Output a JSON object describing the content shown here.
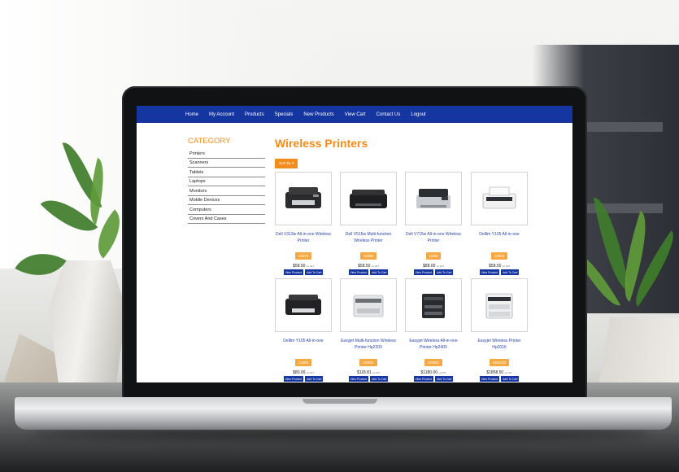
{
  "nav": [
    "Home",
    "My Account",
    "Products",
    "Specials",
    "New Products",
    "View Cart",
    "Contact Us",
    "Logout"
  ],
  "sidebar": {
    "title": "CATEGORY",
    "items": [
      "Printers",
      "Scanners",
      "Tablets",
      "Laptops",
      "Monitors",
      "Mobile Devices",
      "Computers",
      "Covers And Cases"
    ]
  },
  "page": {
    "title": "Wireless Printers",
    "sort_label": "Sort By ▾"
  },
  "products": [
    {
      "name": "Dell V313w All-in-one Wireless Printer",
      "sku": "1X0Y6",
      "price": "$58.50",
      "tax": "inc GST",
      "view": "View Product",
      "cart": "Add To Cart"
    },
    {
      "name": "Dell V515w Multi-function Wireless Printer",
      "sku": "1X0B0",
      "price": "$58.50",
      "tax": "inc GST",
      "view": "View Product",
      "cart": "Add To Cart"
    },
    {
      "name": "Dell V715w All-in-one Wireless Printer",
      "sku": "1X0I8",
      "price": "$88.00",
      "tax": "inc GST",
      "view": "View Product",
      "cart": "Add To Cart"
    },
    {
      "name": "Delltm Y105 All-in-one",
      "sku": "1X004",
      "price": "$58.50",
      "tax": "inc GST",
      "view": "View Product",
      "cart": "Add To Cart"
    },
    {
      "name": "Delltm Y105 All-in-one",
      "sku": "1X0D8",
      "price": "$80.00",
      "tax": "inc GST",
      "view": "View Product",
      "cart": "Add To Cart"
    },
    {
      "name": "Easyjet Multi-function Wireless Printer Hp2200",
      "sku": "HM001",
      "price": "$118.81",
      "tax": "inc GST",
      "view": "View Product",
      "cart": "Add To Cart"
    },
    {
      "name": "Easyjet Wireless All-in-one Printer Hp2400",
      "sku": "HM002",
      "price": "$1180.00",
      "tax": "inc GST",
      "view": "View Product",
      "cart": "Add To Cart"
    },
    {
      "name": "Easyjet Wireless Printer Hp2016",
      "sku": "HGM100",
      "price": "$1858.50",
      "tax": "inc GST",
      "view": "View Product",
      "cart": "Add To Cart"
    }
  ],
  "colors": {
    "nav": "#1536a0",
    "accent": "#f28c1e",
    "sku_badge": "#f5a940",
    "link": "#2a43a8"
  }
}
